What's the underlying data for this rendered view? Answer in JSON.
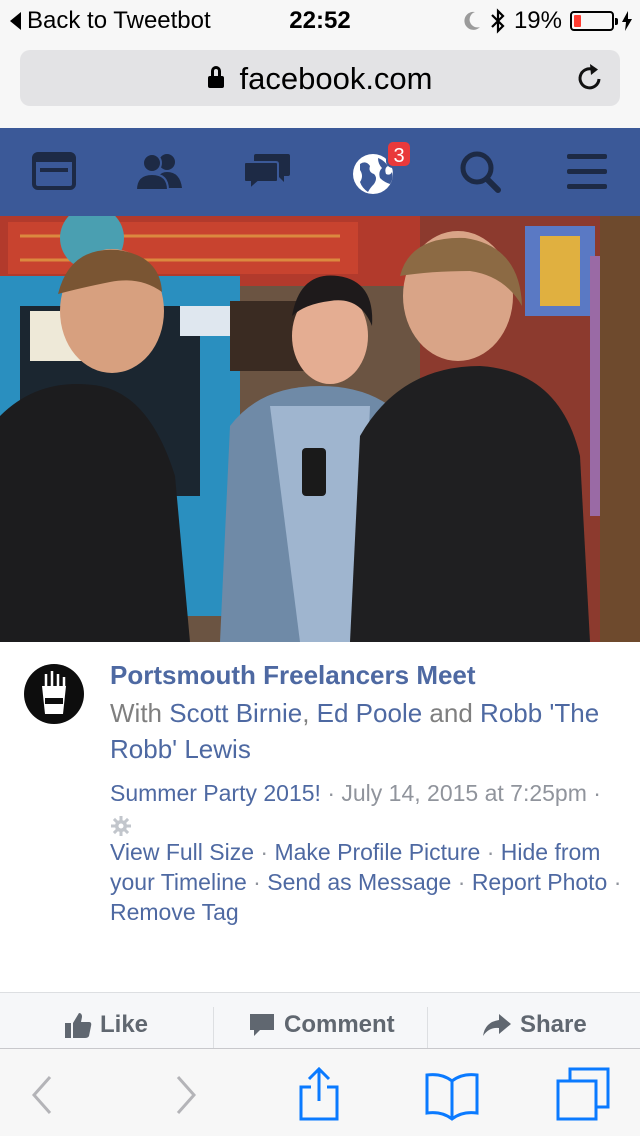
{
  "status_bar": {
    "back_label": "Back to Tweetbot",
    "time": "22:52",
    "battery_text": "19%",
    "battery_level": 0.19,
    "battery_color": "#ff3b30",
    "icons": [
      "moon-icon",
      "bluetooth-icon",
      "battery-icon",
      "charging-bolt-icon"
    ]
  },
  "browser": {
    "url": "facebook.com",
    "icons": [
      "lock-icon",
      "reload-icon"
    ]
  },
  "fb_nav": {
    "bg_color": "#3b5998",
    "items": [
      {
        "name": "news-feed-icon"
      },
      {
        "name": "friend-requests-icon"
      },
      {
        "name": "messages-icon"
      },
      {
        "name": "notifications-globe-icon",
        "badge": "3"
      },
      {
        "name": "search-icon"
      },
      {
        "name": "menu-icon"
      }
    ]
  },
  "post": {
    "page_name": "Portsmouth Freelancers Meet",
    "with_prefix": "With",
    "tagged": [
      "Scott Birnie",
      "Ed Poole",
      "Robb 'The Robb' Lewis"
    ],
    "separator_comma": ",",
    "separator_and": "and",
    "album": "Summer Party 2015!",
    "dot": "·",
    "timestamp": "July 14, 2015 at 7:25pm",
    "privacy_icon": "gear-icon",
    "actions": [
      "View Full Size",
      "Make Profile Picture",
      "Hide from your Timeline",
      "Send as Message",
      "Report Photo",
      "Remove Tag"
    ],
    "link_color": "#4e69a2"
  },
  "action_bar": {
    "like": "Like",
    "comment": "Comment",
    "share": "Share"
  },
  "toolbar": {
    "icons": [
      "back-arrow-icon",
      "forward-arrow-icon",
      "share-icon",
      "bookmarks-icon",
      "tabs-icon"
    ],
    "accent": "#0a7aff"
  }
}
